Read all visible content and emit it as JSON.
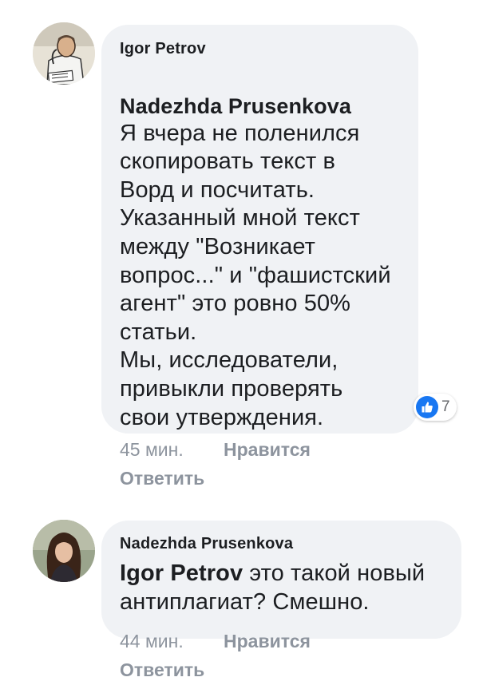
{
  "comments": [
    {
      "author": "Igor Petrov",
      "reply_to": "Nadezhda Prusenkova",
      "text": "Я вчера не поленился\nскопировать текст в\nВорд и посчитать.\nУказанный мной текст\nмежду \"Возникает\nвопрос...\" и \"фашистский\nагент\" это ровно 50%\nстатьи.\nМы, исследователи,\nпривыкли проверять\nсвои утверждения.",
      "reaction_icon": "thumbs-up-icon",
      "reaction_count": "7",
      "time": "45 мин.",
      "like_label": "Нравится",
      "reply_label": "Ответить"
    },
    {
      "author": "Nadezhda Prusenkova",
      "reply_to": "Igor Petrov",
      "text": " это такой новый\nантиплагиат? Смешно.",
      "time": "44 мин.",
      "like_label": "Нравится",
      "reply_label": "Ответить"
    }
  ],
  "colors": {
    "bubble": "#f0f2f5",
    "text": "#1c1e21",
    "meta": "#8d949e",
    "like_blue": "#1877f2"
  }
}
